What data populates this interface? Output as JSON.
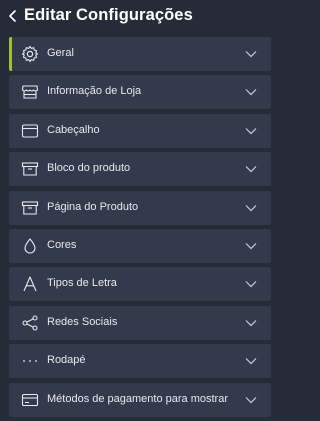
{
  "header": {
    "title": "Editar Configurações"
  },
  "menu": {
    "items": [
      {
        "label": "Geral",
        "icon": "gear-icon"
      },
      {
        "label": "Informação de Loja",
        "icon": "store-icon"
      },
      {
        "label": "Cabeçalho",
        "icon": "header-layout-icon"
      },
      {
        "label": "Bloco do produto",
        "icon": "product-box-icon"
      },
      {
        "label": "Página do Produto",
        "icon": "product-page-icon"
      },
      {
        "label": "Cores",
        "icon": "drop-icon"
      },
      {
        "label": "Tipos de Letra",
        "icon": "font-icon"
      },
      {
        "label": "Redes Sociais",
        "icon": "share-icon"
      },
      {
        "label": "Rodapé",
        "icon": "more-dots-icon"
      },
      {
        "label": "Métodos de pagamento para mostrar",
        "icon": "credit-card-icon"
      }
    ],
    "active_index": 0
  },
  "colors": {
    "background": "#262b38",
    "item_background": "#333a4b",
    "accent": "#9ec22d",
    "text": "#e8eaf0"
  }
}
